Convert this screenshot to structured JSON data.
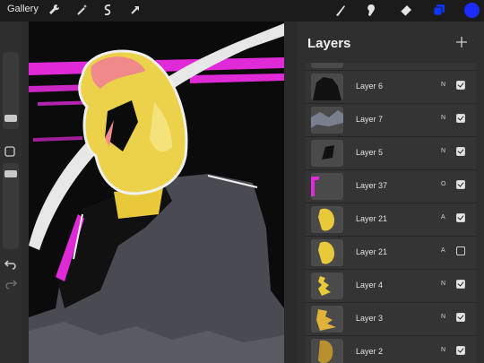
{
  "app": {
    "gallery_label": "Gallery",
    "accent_color": "#0d35ff",
    "current_color": "#1a2cff"
  },
  "toolbar": {
    "left_tools": [
      "wrench-icon",
      "magic-wand-icon",
      "selection-icon",
      "transform-arrow-icon"
    ],
    "right_tools": [
      "brush-icon",
      "smudge-icon",
      "eraser-icon",
      "layers-icon",
      "color-icon"
    ]
  },
  "sidebar": {
    "tools": [
      "brush-size-slider",
      "modifier-square-icon",
      "opacity-slider",
      "undo-icon",
      "redo-icon"
    ]
  },
  "layers_panel": {
    "title": "Layers",
    "add_icon": "plus-icon",
    "layers": [
      {
        "name": "Layer 6",
        "blend": "N",
        "visible": true
      },
      {
        "name": "Layer 7",
        "blend": "N",
        "visible": true
      },
      {
        "name": "Layer 5",
        "blend": "N",
        "visible": true
      },
      {
        "name": "Layer 37",
        "blend": "O",
        "visible": true
      },
      {
        "name": "Layer 21",
        "blend": "A",
        "visible": true
      },
      {
        "name": "Layer 21",
        "blend": "A",
        "visible": false
      },
      {
        "name": "Layer 4",
        "blend": "N",
        "visible": true
      },
      {
        "name": "Layer 3",
        "blend": "N",
        "visible": true
      },
      {
        "name": "Layer 2",
        "blend": "N",
        "visible": true
      }
    ]
  }
}
